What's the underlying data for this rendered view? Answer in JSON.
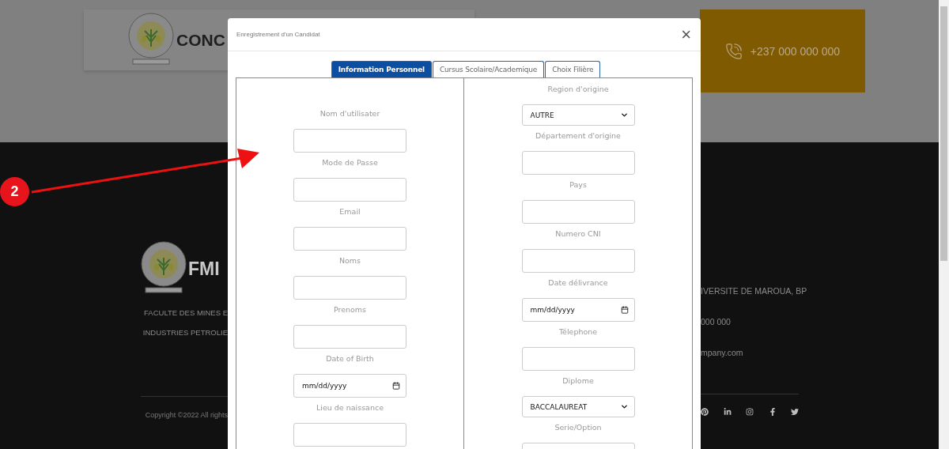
{
  "header": {
    "brand": "CONC",
    "phone": "+237 000 000 000"
  },
  "footer": {
    "brand": "FMI",
    "description": [
      "FACULTE DES MINES E",
      "INDUSTRIES PETROLIE"
    ],
    "contact": [
      "IVERSITE DE MAROUA, BP",
      "000 000",
      "mpany.com"
    ],
    "copyright": "Copyright ©2022 All rights"
  },
  "modal": {
    "title": "Enregistrement d'un Candidat",
    "close": "×",
    "tabs": [
      {
        "label": "Information Personnel",
        "selected": true
      },
      {
        "label": "Cursus Scolaire/Academique",
        "selected": false
      },
      {
        "label": "Choix Filière",
        "selected": false
      }
    ],
    "columns": [
      {
        "fields": [
          {
            "label": "Nom d'utilisater",
            "kind": "text"
          },
          {
            "label": "Mode de Passe",
            "kind": "text"
          },
          {
            "label": "Email",
            "kind": "text"
          },
          {
            "label": "Noms",
            "kind": "text"
          },
          {
            "label": "Prenoms",
            "kind": "text"
          },
          {
            "label": "Date of Birth",
            "kind": "date",
            "value": "mm/dd/yyyy"
          },
          {
            "label": "Lieu de naissance",
            "kind": "text"
          }
        ]
      },
      {
        "fields": [
          {
            "label": "Region d'origine",
            "kind": "select",
            "value": "AUTRE"
          },
          {
            "label": "Département d'origine",
            "kind": "text"
          },
          {
            "label": "Pays",
            "kind": "text"
          },
          {
            "label": "Numero CNI",
            "kind": "text"
          },
          {
            "label": "Date délivrance",
            "kind": "date",
            "value": "mm/dd/yyyy"
          },
          {
            "label": "Télephone",
            "kind": "text"
          },
          {
            "label": "Diplome",
            "kind": "select",
            "value": "BACCALAUREAT"
          },
          {
            "label": "Serie/Option",
            "kind": "text"
          }
        ]
      }
    ]
  },
  "annotation": {
    "number": "2"
  }
}
